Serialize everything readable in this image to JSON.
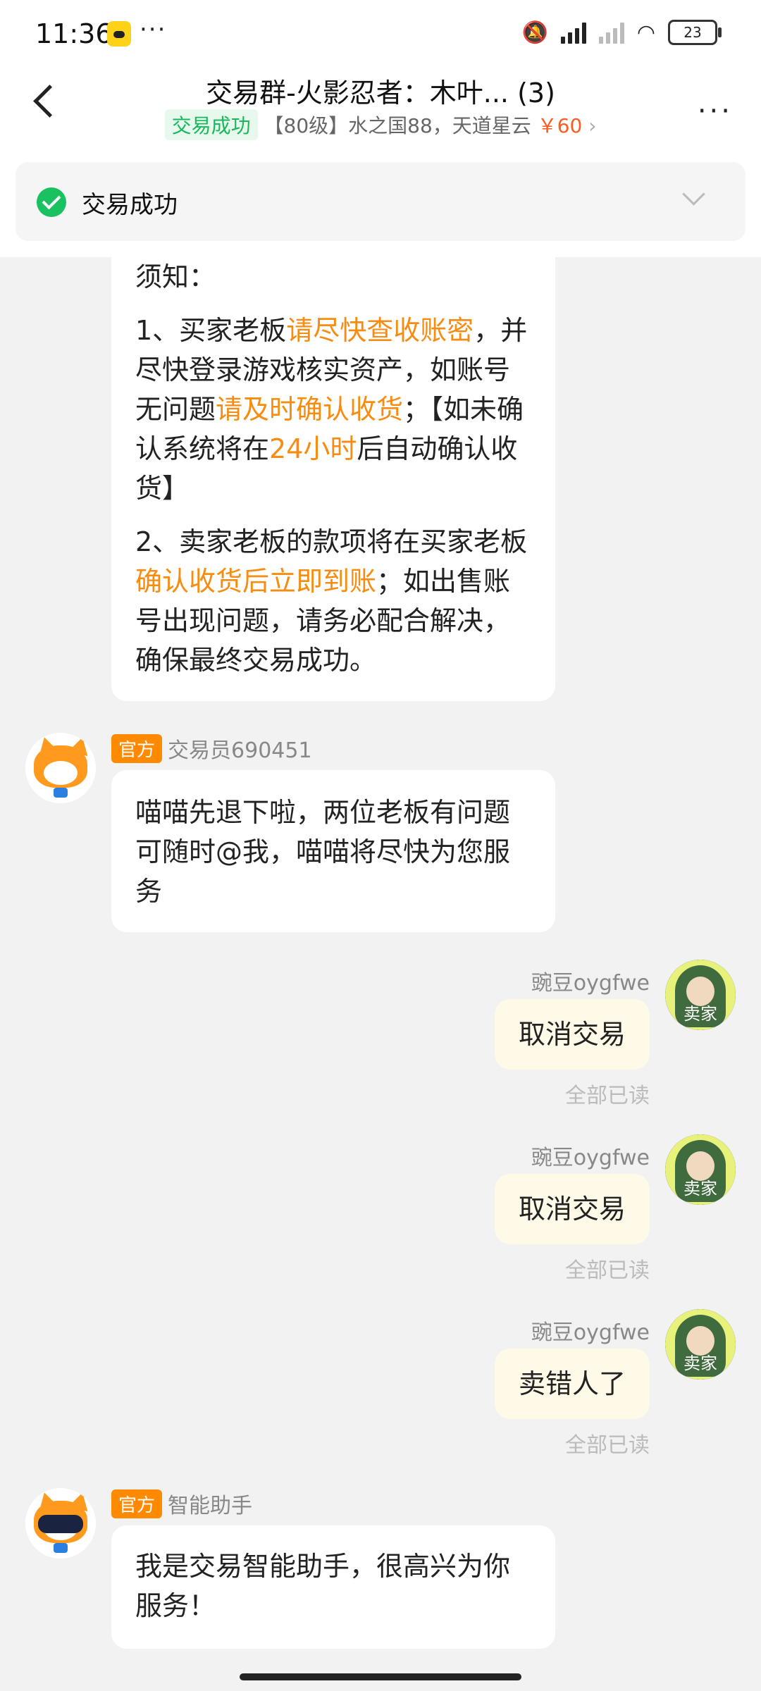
{
  "status_bar": {
    "time": "11:36",
    "dots": "···",
    "battery": "23"
  },
  "header": {
    "title": "交易群-火影忍者：木叶... (3)",
    "status_tag": "交易成功",
    "item_desc": "【80级】水之国88，天道星云",
    "price": "￥60",
    "more_label": "···"
  },
  "success_bar": {
    "text": "交易成功"
  },
  "messages": [
    {
      "paragraphs": [
        {
          "parts": [
            "须知："
          ]
        },
        {
          "parts": [
            "1、买家老板",
            "请尽快查收账密",
            "，并尽快登录游戏核实资产，如账号无问题",
            "请及时确认收货",
            "；【如未确认系统将在",
            "24小时",
            "后自动确认收货】"
          ]
        },
        {
          "parts": [
            "2、卖家老板的款项将在买家老板",
            "确认收货后立即到账",
            "；如出售账号出现问题，请务必配合解决，确保最终交易成功。"
          ]
        }
      ]
    },
    {
      "badge": "官方",
      "sender": "交易员690451",
      "text": "喵喵先退下啦，两位老板有问题可随时@我，喵喵将尽快为您服务"
    },
    {
      "sender": "豌豆oygfwe",
      "avatar_label": "卖家",
      "text": "取消交易",
      "read": "全部已读"
    },
    {
      "sender": "豌豆oygfwe",
      "avatar_label": "卖家",
      "text": "取消交易",
      "read": "全部已读"
    },
    {
      "sender": "豌豆oygfwe",
      "avatar_label": "卖家",
      "text": "卖错人了",
      "read": "全部已读"
    },
    {
      "badge": "官方",
      "sender": "智能助手",
      "text": "我是交易智能助手，很高兴为你服务！"
    }
  ],
  "colors": {
    "accent_orange": "#f78c11",
    "success_green": "#19c161",
    "price_red": "#ff5a1f"
  }
}
